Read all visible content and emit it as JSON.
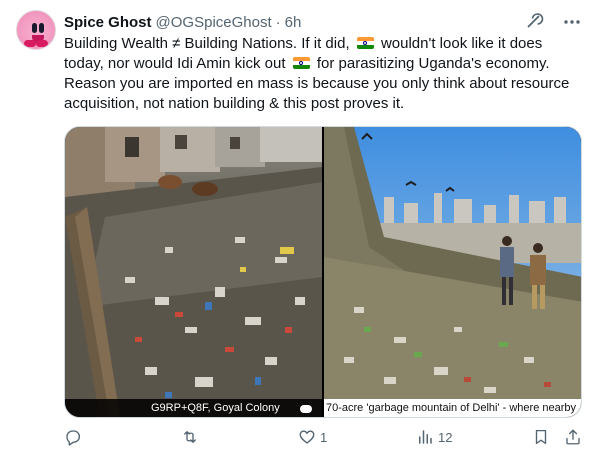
{
  "author": {
    "name": "Spice Ghost",
    "handle": "@OGSpiceGhost",
    "separator": "·",
    "time": "6h",
    "avatar_icon": "kirby-avatar"
  },
  "header_icons": [
    "grok-icon",
    "more-icon"
  ],
  "tweet": {
    "line1_a": "Building Wealth ≠ Building Nations. If it did,",
    "line1_b": "wouldn't look like it does",
    "line2_a": "today, nor would Idi Amin kick out",
    "line2_b": "for parasitizing Uganda's economy.",
    "line3": "Reason you are imported en mass is because you only think about resource",
    "line4": "acquisition, not nation building & this post proves it.",
    "flag_emoji": "🇮🇳"
  },
  "media": {
    "left_caption": "G9RP+Q8F, Goyal Colony",
    "right_caption": "70-acre 'garbage mountain of Delhi' - where nearby"
  },
  "actions": {
    "reply_count": "",
    "retweet_count": "",
    "like_count": "1",
    "views_count": "12"
  },
  "colors": {
    "text": "#0f1419",
    "secondary": "#536471",
    "border": "#cfd9de",
    "flag_saffron": "#ff9933",
    "flag_green": "#138808",
    "flag_chakra": "#000080"
  }
}
